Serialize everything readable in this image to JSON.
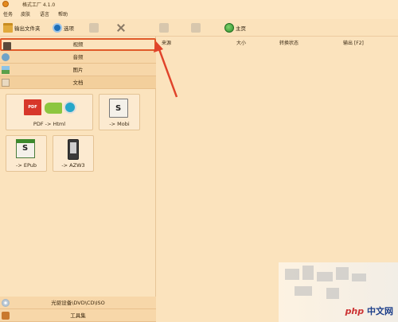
{
  "titlebar": {
    "title": "格式工厂 4.1.0"
  },
  "menubar": {
    "items": [
      "任务",
      "皮肤",
      "语言",
      "帮助"
    ]
  },
  "toolbar": {
    "output_folder": "输出文件夹",
    "options": "选项",
    "home": "主页"
  },
  "categories": {
    "video": "视频",
    "audio": "音频",
    "image": "图片",
    "document": "文档",
    "cd": "光驱设备\\DVD\\CD\\ISO",
    "tools": "工具集"
  },
  "tiles": {
    "pdf_html": "PDF -> Html",
    "mobi": "-> Mobi",
    "epub": "-> EPub",
    "azw3": "-> AZW3",
    "pdf_badge": "PDF"
  },
  "columns": {
    "source": "来源",
    "size": "大小",
    "status": "转换状态",
    "output": "输出 [F2]"
  },
  "watermark": {
    "php": "php",
    "site": "中文网"
  },
  "colors": {
    "background": "#fbe3bd",
    "highlight_border": "#e05a2a",
    "arrow": "#e0432a"
  }
}
